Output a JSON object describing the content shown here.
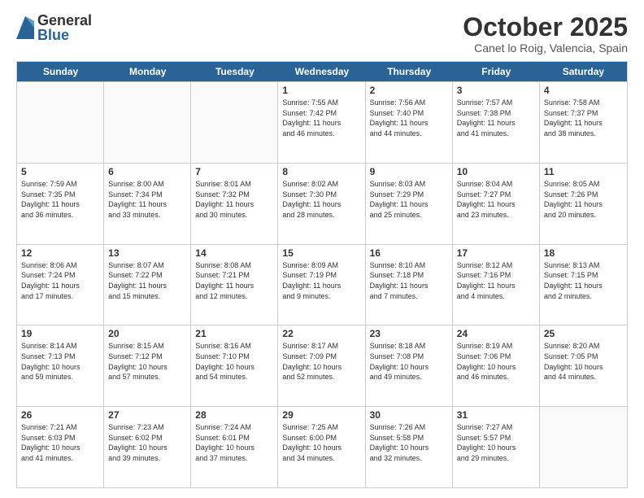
{
  "logo": {
    "general": "General",
    "blue": "Blue"
  },
  "title": "October 2025",
  "location": "Canet lo Roig, Valencia, Spain",
  "days": [
    "Sunday",
    "Monday",
    "Tuesday",
    "Wednesday",
    "Thursday",
    "Friday",
    "Saturday"
  ],
  "weeks": [
    [
      {
        "day": "",
        "info": ""
      },
      {
        "day": "",
        "info": ""
      },
      {
        "day": "",
        "info": ""
      },
      {
        "day": "1",
        "info": "Sunrise: 7:55 AM\nSunset: 7:42 PM\nDaylight: 11 hours\nand 46 minutes."
      },
      {
        "day": "2",
        "info": "Sunrise: 7:56 AM\nSunset: 7:40 PM\nDaylight: 11 hours\nand 44 minutes."
      },
      {
        "day": "3",
        "info": "Sunrise: 7:57 AM\nSunset: 7:38 PM\nDaylight: 11 hours\nand 41 minutes."
      },
      {
        "day": "4",
        "info": "Sunrise: 7:58 AM\nSunset: 7:37 PM\nDaylight: 11 hours\nand 38 minutes."
      }
    ],
    [
      {
        "day": "5",
        "info": "Sunrise: 7:59 AM\nSunset: 7:35 PM\nDaylight: 11 hours\nand 36 minutes."
      },
      {
        "day": "6",
        "info": "Sunrise: 8:00 AM\nSunset: 7:34 PM\nDaylight: 11 hours\nand 33 minutes."
      },
      {
        "day": "7",
        "info": "Sunrise: 8:01 AM\nSunset: 7:32 PM\nDaylight: 11 hours\nand 30 minutes."
      },
      {
        "day": "8",
        "info": "Sunrise: 8:02 AM\nSunset: 7:30 PM\nDaylight: 11 hours\nand 28 minutes."
      },
      {
        "day": "9",
        "info": "Sunrise: 8:03 AM\nSunset: 7:29 PM\nDaylight: 11 hours\nand 25 minutes."
      },
      {
        "day": "10",
        "info": "Sunrise: 8:04 AM\nSunset: 7:27 PM\nDaylight: 11 hours\nand 23 minutes."
      },
      {
        "day": "11",
        "info": "Sunrise: 8:05 AM\nSunset: 7:26 PM\nDaylight: 11 hours\nand 20 minutes."
      }
    ],
    [
      {
        "day": "12",
        "info": "Sunrise: 8:06 AM\nSunset: 7:24 PM\nDaylight: 11 hours\nand 17 minutes."
      },
      {
        "day": "13",
        "info": "Sunrise: 8:07 AM\nSunset: 7:22 PM\nDaylight: 11 hours\nand 15 minutes."
      },
      {
        "day": "14",
        "info": "Sunrise: 8:08 AM\nSunset: 7:21 PM\nDaylight: 11 hours\nand 12 minutes."
      },
      {
        "day": "15",
        "info": "Sunrise: 8:09 AM\nSunset: 7:19 PM\nDaylight: 11 hours\nand 9 minutes."
      },
      {
        "day": "16",
        "info": "Sunrise: 8:10 AM\nSunset: 7:18 PM\nDaylight: 11 hours\nand 7 minutes."
      },
      {
        "day": "17",
        "info": "Sunrise: 8:12 AM\nSunset: 7:16 PM\nDaylight: 11 hours\nand 4 minutes."
      },
      {
        "day": "18",
        "info": "Sunrise: 8:13 AM\nSunset: 7:15 PM\nDaylight: 11 hours\nand 2 minutes."
      }
    ],
    [
      {
        "day": "19",
        "info": "Sunrise: 8:14 AM\nSunset: 7:13 PM\nDaylight: 10 hours\nand 59 minutes."
      },
      {
        "day": "20",
        "info": "Sunrise: 8:15 AM\nSunset: 7:12 PM\nDaylight: 10 hours\nand 57 minutes."
      },
      {
        "day": "21",
        "info": "Sunrise: 8:16 AM\nSunset: 7:10 PM\nDaylight: 10 hours\nand 54 minutes."
      },
      {
        "day": "22",
        "info": "Sunrise: 8:17 AM\nSunset: 7:09 PM\nDaylight: 10 hours\nand 52 minutes."
      },
      {
        "day": "23",
        "info": "Sunrise: 8:18 AM\nSunset: 7:08 PM\nDaylight: 10 hours\nand 49 minutes."
      },
      {
        "day": "24",
        "info": "Sunrise: 8:19 AM\nSunset: 7:06 PM\nDaylight: 10 hours\nand 46 minutes."
      },
      {
        "day": "25",
        "info": "Sunrise: 8:20 AM\nSunset: 7:05 PM\nDaylight: 10 hours\nand 44 minutes."
      }
    ],
    [
      {
        "day": "26",
        "info": "Sunrise: 7:21 AM\nSunset: 6:03 PM\nDaylight: 10 hours\nand 41 minutes."
      },
      {
        "day": "27",
        "info": "Sunrise: 7:23 AM\nSunset: 6:02 PM\nDaylight: 10 hours\nand 39 minutes."
      },
      {
        "day": "28",
        "info": "Sunrise: 7:24 AM\nSunset: 6:01 PM\nDaylight: 10 hours\nand 37 minutes."
      },
      {
        "day": "29",
        "info": "Sunrise: 7:25 AM\nSunset: 6:00 PM\nDaylight: 10 hours\nand 34 minutes."
      },
      {
        "day": "30",
        "info": "Sunrise: 7:26 AM\nSunset: 5:58 PM\nDaylight: 10 hours\nand 32 minutes."
      },
      {
        "day": "31",
        "info": "Sunrise: 7:27 AM\nSunset: 5:57 PM\nDaylight: 10 hours\nand 29 minutes."
      },
      {
        "day": "",
        "info": ""
      }
    ]
  ]
}
